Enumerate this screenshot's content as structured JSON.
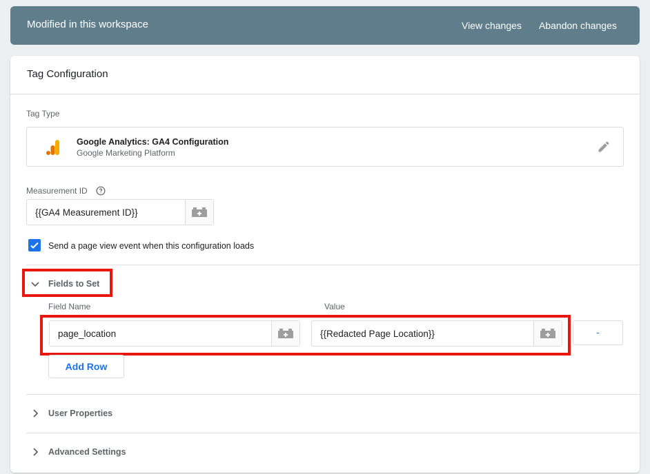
{
  "header": {
    "status": "Modified in this workspace",
    "view_changes": "View changes",
    "abandon_changes": "Abandon changes"
  },
  "card": {
    "title": "Tag Configuration",
    "tag_type_label": "Tag Type",
    "tag_type": {
      "name": "Google Analytics: GA4 Configuration",
      "platform": "Google Marketing Platform",
      "icon": "google-analytics-icon",
      "edit_icon": "pencil-icon"
    },
    "measurement_id": {
      "label": "Measurement ID",
      "value": "{{GA4 Measurement ID}}",
      "help_icon": "help-circle-icon"
    },
    "send_page_view": {
      "checked": true,
      "label": "Send a page view event when this configuration loads"
    },
    "fields_to_set": {
      "title": "Fields to Set",
      "expanded": true,
      "col_field_name": "Field Name",
      "col_value": "Value",
      "rows": [
        {
          "field_name": "page_location",
          "value": "{{Redacted Page Location}}",
          "remove_label": "-"
        }
      ],
      "add_row": "Add Row"
    },
    "user_properties": {
      "title": "User Properties",
      "expanded": false
    },
    "advanced_settings": {
      "title": "Advanced Settings",
      "expanded": false
    }
  },
  "colors": {
    "header_bg": "#607d8b",
    "accent_blue": "#1a73e8",
    "highlight_red": "#e8160c",
    "ga_orange": "#f9ab00",
    "ga_dark_orange": "#e37400"
  }
}
